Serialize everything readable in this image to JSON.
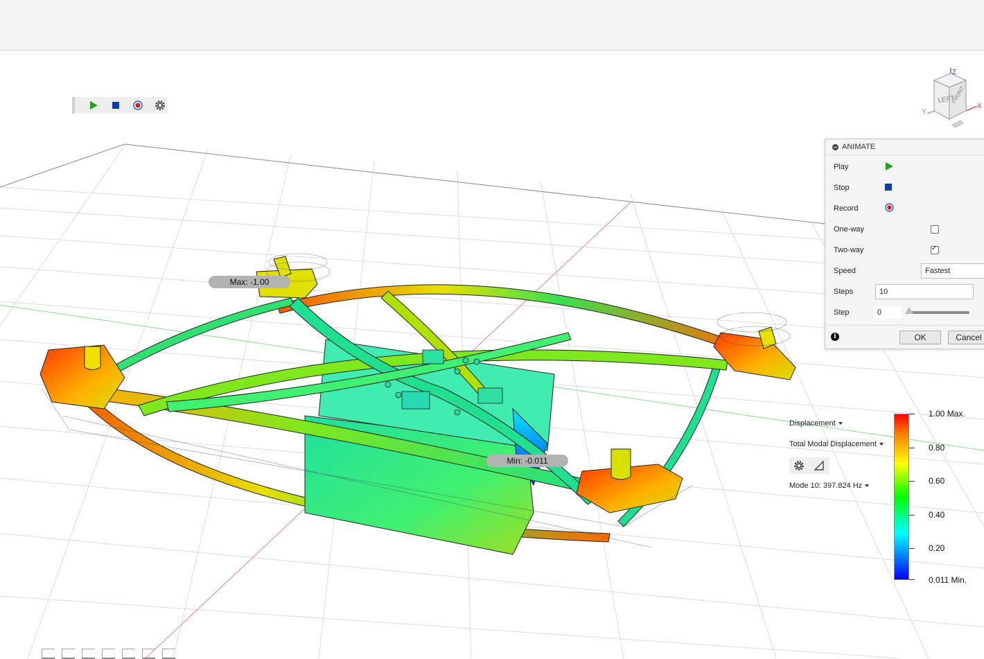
{
  "animation_toolbar": {
    "play": "play-icon",
    "stop": "stop-icon",
    "record": "record-icon",
    "settings": "gear-icon"
  },
  "viewcube": {
    "left_face": "LEFT",
    "front_face": "FRONT",
    "axis_x": "X",
    "axis_y": "Y",
    "axis_z": "Z"
  },
  "animate_panel": {
    "title": "ANIMATE",
    "play_label": "Play",
    "stop_label": "Stop",
    "record_label": "Record",
    "one_way_label": "One-way",
    "one_way_checked": false,
    "two_way_label": "Two-way",
    "two_way_checked": true,
    "speed_label": "Speed",
    "speed_value": "Fastest",
    "steps_label": "Steps",
    "steps_value": "10",
    "step_label": "Step",
    "step_value": "0",
    "ok_label": "OK",
    "cancel_label": "Cancel",
    "colors": {
      "play": "#1aa51a",
      "stop": "#0b3fa8",
      "record": "#d61a1a"
    }
  },
  "callouts": {
    "max": "Max: -1.00",
    "min": "Min: -0.011"
  },
  "results": {
    "result_type": "Displacement",
    "component": "Total Modal Displacement",
    "mode": "Mode 10: 397.824 Hz"
  },
  "legend": {
    "labels": [
      "1.00 Max.",
      "0.80",
      "0.60",
      "0.40",
      "0.20",
      "0.011 Min."
    ],
    "colors": [
      "#ff0000",
      "#ffff00",
      "#00ff00",
      "#00ffff",
      "#0000ff"
    ]
  }
}
